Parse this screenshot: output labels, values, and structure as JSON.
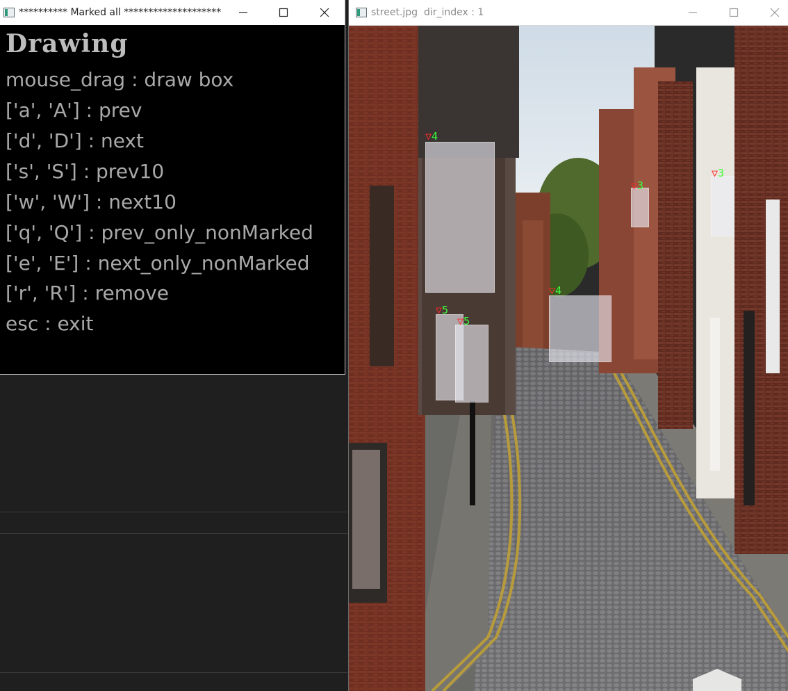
{
  "left_window": {
    "title": "********** Marked all ********************",
    "controls": [
      "minimize",
      "maximize",
      "close"
    ],
    "info": {
      "heading": "Drawing",
      "lines": [
        "mouse_drag : draw box",
        "['a', 'A'] : prev",
        "['d', 'D'] : next",
        "['s', 'S'] : prev10",
        "['w', 'W'] : next10",
        "['q', 'Q'] : prev_only_nonMarked",
        "['e', 'E'] : next_only_nonMarked",
        "['r', 'R'] : remove",
        "esc : exit"
      ]
    }
  },
  "right_window": {
    "title": "street.jpg  dir_index : 1",
    "controls": [
      "minimize",
      "maximize",
      "close"
    ],
    "image_name": "street.jpg",
    "boxes": [
      {
        "label": "4",
        "marker": "▽"
      },
      {
        "label": "3",
        "marker": "▽"
      },
      {
        "label": "3",
        "marker": "▽"
      },
      {
        "label": "4",
        "marker": "▽"
      },
      {
        "label": "5",
        "marker": "▽"
      },
      {
        "label": "5",
        "marker": "▽"
      }
    ]
  },
  "colors": {
    "marker": "#ff2a2a",
    "label": "#3dff3d",
    "info_text": "#a9a9a9",
    "canvas_bg": "#000000",
    "desktop_bg": "#1f1f1f"
  }
}
